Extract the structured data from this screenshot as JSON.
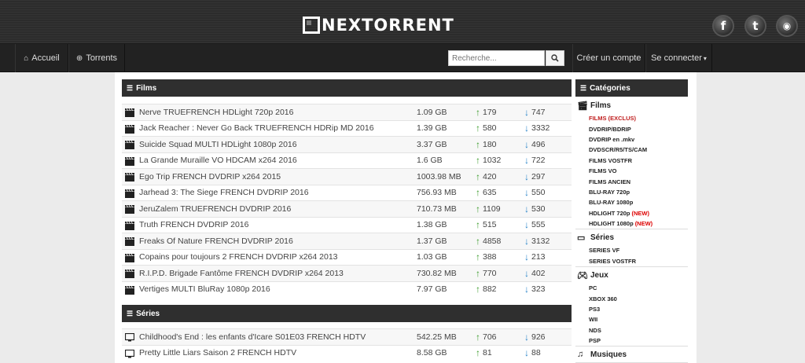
{
  "brand": {
    "logo_text": "NEXTORRENT"
  },
  "social": [
    {
      "icon": "facebook-icon",
      "glyph": "f"
    },
    {
      "icon": "twitter-icon",
      "glyph": "t"
    },
    {
      "icon": "rss-icon",
      "glyph": "◉"
    }
  ],
  "nav": {
    "home_label": "Accueil",
    "torrents_label": "Torrents",
    "search_placeholder": "Recherche...",
    "register_label": "Créer un compte",
    "login_label": "Se connecter",
    "login_caret": "▾"
  },
  "films": {
    "title": "Films",
    "rows": [
      {
        "name": "Nerve TRUEFRENCH HDLight 720p 2016",
        "size": "1.09 GB",
        "seeders": "179",
        "leechers": "747"
      },
      {
        "name": "Jack Reacher : Never Go Back TRUEFRENCH HDRip MD 2016",
        "size": "1.39 GB",
        "seeders": "580",
        "leechers": "3332"
      },
      {
        "name": "Suicide Squad MULTI HDLight 1080p 2016",
        "size": "3.37 GB",
        "seeders": "180",
        "leechers": "496"
      },
      {
        "name": "La Grande Muraille VO HDCAM x264 2016",
        "size": "1.6 GB",
        "seeders": "1032",
        "leechers": "722"
      },
      {
        "name": "Ego Trip FRENCH DVDRIP x264 2015",
        "size": "1003.98 MB",
        "seeders": "420",
        "leechers": "297"
      },
      {
        "name": "Jarhead 3: The Siege FRENCH DVDRIP 2016",
        "size": "756.93 MB",
        "seeders": "635",
        "leechers": "550"
      },
      {
        "name": "JeruZalem TRUEFRENCH DVDRIP 2016",
        "size": "710.73 MB",
        "seeders": "1109",
        "leechers": "530"
      },
      {
        "name": "Truth FRENCH DVDRIP 2016",
        "size": "1.38 GB",
        "seeders": "515",
        "leechers": "555"
      },
      {
        "name": "Freaks Of Nature FRENCH DVDRIP 2016",
        "size": "1.37 GB",
        "seeders": "4858",
        "leechers": "3132"
      },
      {
        "name": "Copains pour toujours 2 FRENCH DVDRIP x264 2013",
        "size": "1.03 GB",
        "seeders": "388",
        "leechers": "213"
      },
      {
        "name": "R.I.P.D. Brigade Fantôme FRENCH DVDRIP x264 2013",
        "size": "730.82 MB",
        "seeders": "770",
        "leechers": "402"
      },
      {
        "name": "Vertiges MULTI BluRay 1080p 2016",
        "size": "7.97 GB",
        "seeders": "882",
        "leechers": "323"
      }
    ]
  },
  "series": {
    "title": "Séries",
    "rows": [
      {
        "name": "Childhood's End : les enfants d'Icare S01E03 FRENCH HDTV",
        "size": "542.25 MB",
        "seeders": "706",
        "leechers": "926"
      },
      {
        "name": "Pretty Little Liars Saison 2 FRENCH HDTV",
        "size": "8.58 GB",
        "seeders": "81",
        "leechers": "88"
      }
    ]
  },
  "categories": {
    "title": "Catégories",
    "new_tag": "(NEW)",
    "groups": [
      {
        "title": "Films",
        "icon": "film-icon",
        "items": [
          {
            "label": "FILMS (EXCLUS)",
            "active": true
          },
          {
            "label": "DVDRIP/BDRIP"
          },
          {
            "label": "DVDRIP en .mkv"
          },
          {
            "label": "DVDSCR/R5/TS/CAM"
          },
          {
            "label": "FILMS VOSTFR"
          },
          {
            "label": "FILMS VO"
          },
          {
            "label": "FILMS ANCIEN"
          },
          {
            "label": "BLU-RAY 720p"
          },
          {
            "label": "BLU-RAY 1080p"
          },
          {
            "label": "HDLIGHT 720p",
            "new": true
          },
          {
            "label": "HDLIGHT 1080p",
            "new": true
          }
        ]
      },
      {
        "title": "Séries",
        "icon": "tv-icon",
        "items": [
          {
            "label": "SERIES VF"
          },
          {
            "label": "SERIES VOSTFR"
          }
        ]
      },
      {
        "title": "Jeux",
        "icon": "gamepad-icon",
        "items": [
          {
            "label": "PC"
          },
          {
            "label": "XBOX 360"
          },
          {
            "label": "PS3"
          },
          {
            "label": "WII"
          },
          {
            "label": "NDS"
          },
          {
            "label": "PSP"
          }
        ]
      },
      {
        "title": "Musiques",
        "icon": "music-icon",
        "items": []
      }
    ]
  }
}
